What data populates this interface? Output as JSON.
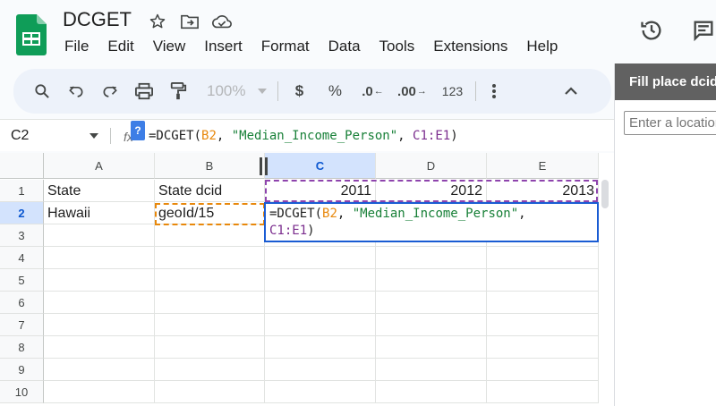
{
  "doc": {
    "title": "DCGET"
  },
  "menu": [
    "File",
    "Edit",
    "View",
    "Insert",
    "Format",
    "Data",
    "Tools",
    "Extensions",
    "Help"
  ],
  "toolbar": {
    "zoom": "100%",
    "currency": "$",
    "percent": "%",
    "decrease_decimal": ".0",
    "increase_decimal": ".00",
    "number_format": "123"
  },
  "formula_bar": {
    "cell_ref": "C2",
    "fx": "fx",
    "help": "?",
    "formula_parts": [
      "=DCGET(",
      "B2",
      ", ",
      "\"Median_Income_Person\"",
      ", ",
      "C1:E1",
      ")"
    ]
  },
  "grid": {
    "columns": [
      "A",
      "B",
      "C",
      "D",
      "E"
    ],
    "selected_column": "C",
    "rows": [
      "1",
      "2",
      "3",
      "4",
      "5",
      "6",
      "7",
      "8",
      "9",
      "10"
    ],
    "selected_row": "2",
    "cells": {
      "A1": "State",
      "B1": "State dcid",
      "C1": "2011",
      "D1": "2012",
      "E1": "2013",
      "A2": "Hawaii",
      "B2": "geoId/15"
    },
    "editor_line1_parts": [
      "=DCGET(",
      "B2",
      ", ",
      "\"Median_Income_Person\"",
      ","
    ],
    "editor_line2_parts": [
      "C1:E1",
      ")"
    ]
  },
  "side_panel": {
    "title": "Fill place dcid",
    "input_placeholder": "Enter a location"
  },
  "colors": {
    "accent": "#0b57d0",
    "ref_orange": "#e8880c",
    "ref_purple": "#8e44ad",
    "string_green": "#188038",
    "sheets_green": "#0f9d58"
  }
}
